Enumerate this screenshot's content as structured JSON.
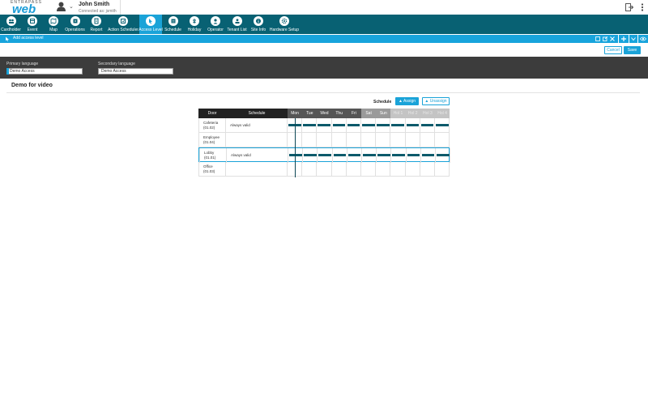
{
  "header": {
    "brand_top": "ENTRAPASS",
    "brand_web": "web",
    "user_name": "John Smith",
    "connected": "Connected as: jsmith"
  },
  "nav": [
    {
      "label": "Cardholder",
      "icon": "cardholder-icon"
    },
    {
      "label": "Event",
      "icon": "event-icon"
    },
    {
      "label": "Map",
      "icon": "map-icon"
    },
    {
      "label": "Operations",
      "icon": "operations-icon"
    },
    {
      "label": "Report",
      "icon": "report-icon"
    },
    {
      "label": "Action Scheduler",
      "icon": "action-scheduler-icon"
    },
    {
      "label": "Access Level",
      "icon": "access-level-icon",
      "active": true
    },
    {
      "label": "Schedule",
      "icon": "schedule-icon"
    },
    {
      "label": "Holiday",
      "icon": "holiday-icon"
    },
    {
      "label": "Operator",
      "icon": "operator-icon"
    },
    {
      "label": "Tenant List",
      "icon": "tenant-list-icon"
    },
    {
      "label": "Site Info",
      "icon": "site-info-icon"
    },
    {
      "label": "Hardware Setup",
      "icon": "hardware-setup-icon"
    }
  ],
  "titlebar": {
    "title": "Add access level"
  },
  "actions": {
    "cancel": "Cancel",
    "save": "Save"
  },
  "language": {
    "primary_label": "Primary language",
    "primary_value": "Demo Access",
    "secondary_label": "Secondary language",
    "secondary_value": "Demo Access"
  },
  "section": {
    "title": "Demo for video"
  },
  "schedule_controls": {
    "label": "Schedule",
    "assign": "Assign",
    "unassign": "Unassign"
  },
  "grid": {
    "col_door": "Door",
    "col_schedule": "Schedule",
    "days": [
      "Mon",
      "Tue",
      "Wed",
      "Thu",
      "Fri",
      "Sat",
      "Sun",
      "Hol 1",
      "Hol 2",
      "Hol 3",
      "Hol 4"
    ],
    "rows": [
      {
        "door": "Cafeteria",
        "num": "(01.02)",
        "schedule": "Always valid",
        "bars": true,
        "selected": false
      },
      {
        "door": "Employee",
        "num": "(01.04)",
        "schedule": "",
        "bars": false,
        "selected": false
      },
      {
        "door": "Lobby",
        "num": "(01.01)",
        "schedule": "Always valid",
        "bars": true,
        "selected": true
      },
      {
        "door": "Office",
        "num": "(01.03)",
        "schedule": "",
        "bars": false,
        "selected": false
      }
    ]
  },
  "colors": {
    "nav_bg": "#086173",
    "accent": "#1aa3d8",
    "bar": "#0b5a6b",
    "band": "#3c3c3c"
  }
}
